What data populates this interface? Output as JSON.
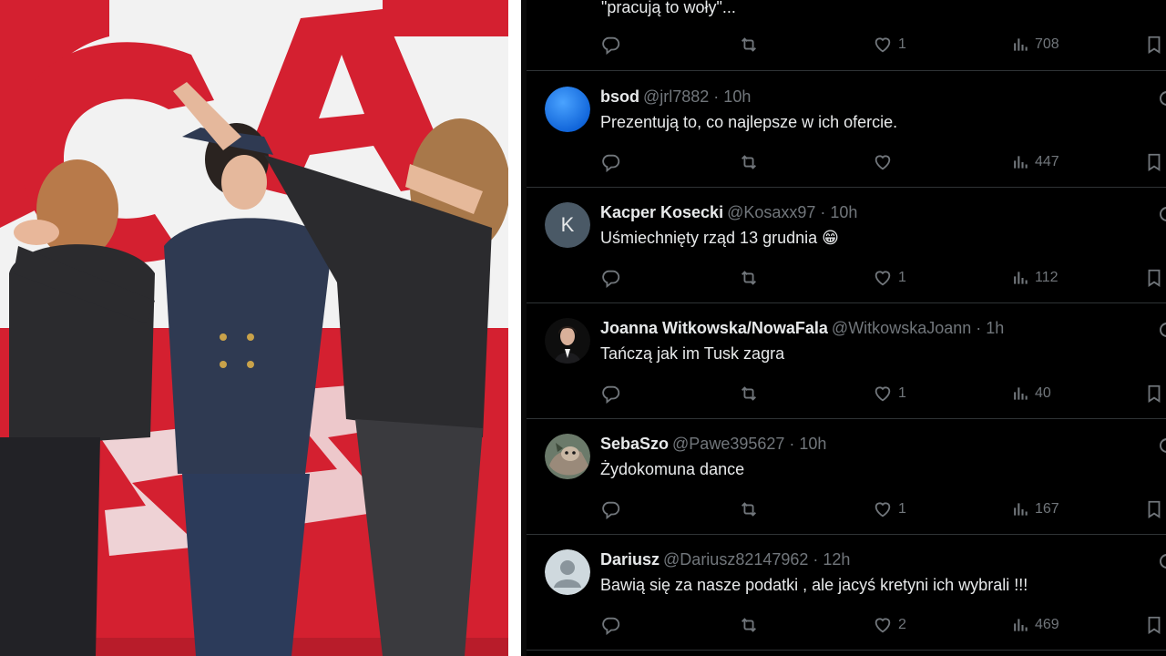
{
  "top_reply": {
    "text": "\"pracują to woły\"...",
    "likes": "1",
    "views": "708"
  },
  "tweets": [
    {
      "name": "bsod",
      "handle": "@jrl7882 · 10h",
      "text": "Prezentują to, co najlepsze w ich ofercie.",
      "likes": "",
      "views": "447",
      "avatar": "blue-circle-avatar"
    },
    {
      "name": "Kacper Kosecki",
      "handle": "@Kosaxx97 · 10h",
      "text": "Uśmiechnięty rząd 13 grudnia  😁",
      "likes": "1",
      "views": "112",
      "avatar": "letter-avatar",
      "avatar_letter": "K"
    },
    {
      "name": "Joanna Witkowska/NowaFala",
      "handle": "@WitkowskaJoann · 1h",
      "text": "Tańczą jak im Tusk zagra",
      "likes": "1",
      "views": "40",
      "avatar": "portrait-avatar"
    },
    {
      "name": "SebaSzo",
      "handle": "@Pawe395627 · 10h",
      "text": "Żydokomuna dance",
      "likes": "1",
      "views": "167",
      "avatar": "animal-photo-avatar"
    },
    {
      "name": "Dariusz",
      "handle": "@Dariusz82147962 · 12h",
      "text": "Bawią się za nasze podatki , ale jacyś kretyni ich wybrali !!!",
      "likes": "2",
      "views": "469",
      "avatar": "default-person-avatar"
    }
  ],
  "photo": {
    "description_icon": "three-women-dabbing-photo",
    "banner_color": "#d42030"
  },
  "colors": {
    "background": "#000000",
    "text": "#e7e9ea",
    "muted": "#71767b",
    "divider": "#2f3336"
  }
}
